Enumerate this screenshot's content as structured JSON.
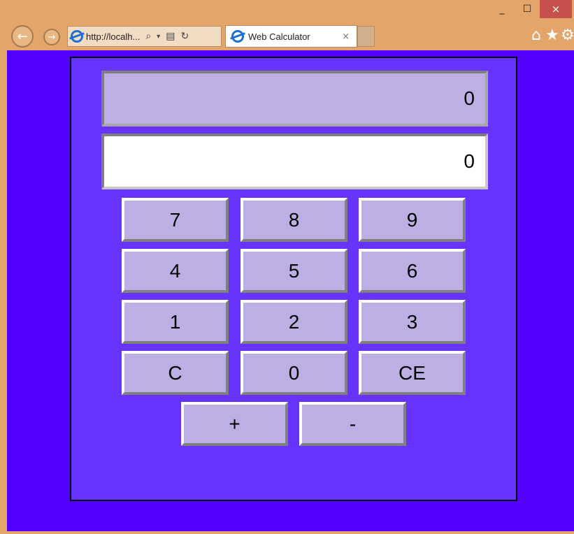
{
  "window": {
    "minimize_glyph": "_",
    "maximize_glyph": "☐",
    "close_glyph": "×"
  },
  "browser": {
    "url": "http://localh...",
    "tab_title": "Web Calculator",
    "tab_close_glyph": "×",
    "icons": [
      "back-icon",
      "forward-icon",
      "ie-icon",
      "search-icon",
      "dropdown-icon",
      "compat-view-icon",
      "refresh-icon",
      "home-icon",
      "favorites-star-icon",
      "gear-icon"
    ]
  },
  "calculator": {
    "upper_display": "0",
    "lower_display": "0",
    "keys": {
      "k7": "7",
      "k8": "8",
      "k9": "9",
      "k4": "4",
      "k5": "5",
      "k6": "6",
      "k1": "1",
      "k2": "2",
      "k3": "3",
      "kc": "C",
      "k0": "0",
      "kce": "CE",
      "kplus": "+",
      "kminus": "-"
    },
    "colors": {
      "page_bg": "#5400ff",
      "panel_bg": "#6633ff",
      "key_bg": "#bbafe3",
      "display_bg": "#ffffff"
    }
  }
}
